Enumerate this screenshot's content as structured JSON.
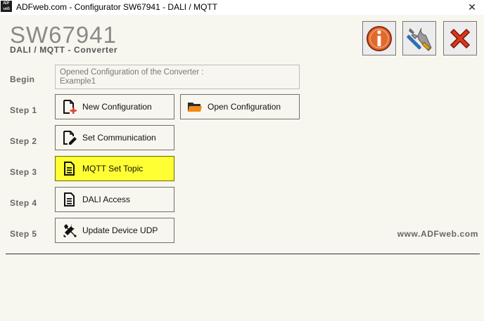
{
  "window": {
    "title": "ADFweb.com - Configurator SW67941 - DALI / MQTT",
    "app_icon_text": "ADF web",
    "close_glyph": "✕"
  },
  "header": {
    "product_code": "SW67941",
    "subtitle": "DALI / MQTT - Converter"
  },
  "toolbar": {
    "info_icon": "info-icon",
    "settings_icon": "wrench-screwdriver-icon",
    "exit_icon": "red-x-icon"
  },
  "steps": {
    "begin": {
      "label": "Begin",
      "status_line1": "Opened Configuration of the Converter :",
      "status_line2": "Example1"
    },
    "step1": {
      "label": "Step 1",
      "new_config": "New Configuration",
      "open_config": "Open Configuration"
    },
    "step2": {
      "label": "Step 2",
      "button": "Set Communication"
    },
    "step3": {
      "label": "Step 3",
      "button": "MQTT Set Topic",
      "active": true
    },
    "step4": {
      "label": "Step 4",
      "button": "DALI Access"
    },
    "step5": {
      "label": "Step 5",
      "button": "Update Device UDP"
    }
  },
  "footer": {
    "website": "www.ADFweb.com"
  },
  "colors": {
    "active_button": "#ffff33",
    "accent_red": "#d9381e",
    "background": "#f8f7ef"
  }
}
